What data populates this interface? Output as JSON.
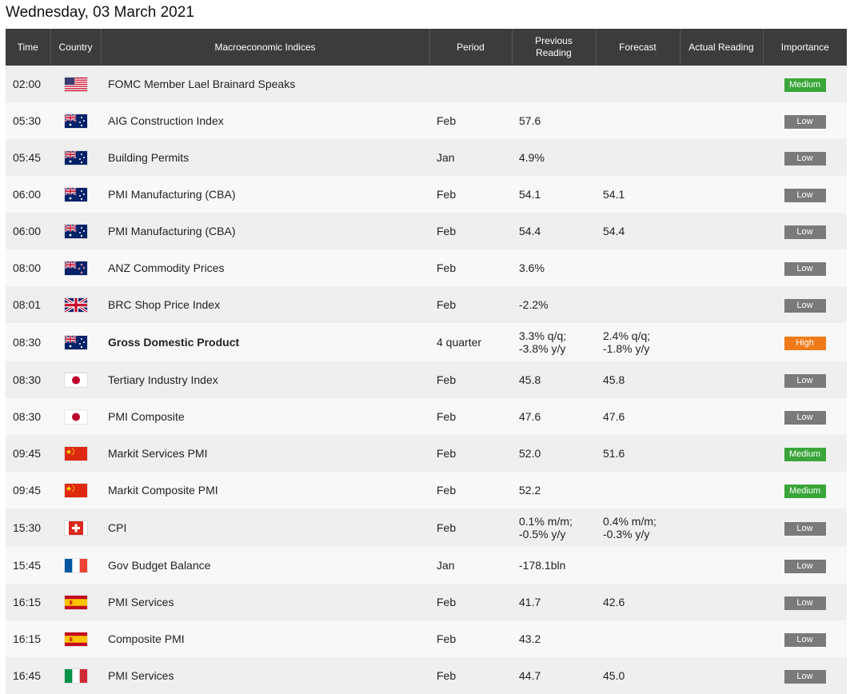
{
  "date_title": "Wednesday, 03 March 2021",
  "headers": {
    "time": "Time",
    "country": "Country",
    "indices": "Macroeconomic Indices",
    "period": "Period",
    "previous": "Previous\nReading",
    "forecast": "Forecast",
    "actual": "Actual Reading",
    "importance": "Importance"
  },
  "colors": {
    "header_bg": "#3c3c3c",
    "low": "#7a7a7a",
    "medium": "#3aa63a",
    "high": "#f07a18"
  },
  "rows": [
    {
      "time": "02:00",
      "flag": "us",
      "flag_name": "us-flag-icon",
      "event": "FOMC Member Lael Brainard Speaks",
      "period": "",
      "previous": "",
      "forecast": "",
      "actual": "",
      "importance": "Medium",
      "level": "medium",
      "bold": false
    },
    {
      "time": "05:30",
      "flag": "au",
      "flag_name": "australia-flag-icon",
      "event": "AIG Construction Index",
      "period": "Feb",
      "previous": "57.6",
      "forecast": "",
      "actual": "",
      "importance": "Low",
      "level": "low",
      "bold": false
    },
    {
      "time": "05:45",
      "flag": "au",
      "flag_name": "australia-flag-icon",
      "event": "Building Permits",
      "period": "Jan",
      "previous": "4.9%",
      "forecast": "",
      "actual": "",
      "importance": "Low",
      "level": "low",
      "bold": false
    },
    {
      "time": "06:00",
      "flag": "au",
      "flag_name": "australia-flag-icon",
      "event": "PMI Manufacturing (CBA)",
      "period": "Feb",
      "previous": "54.1",
      "forecast": "54.1",
      "actual": "",
      "importance": "Low",
      "level": "low",
      "bold": false
    },
    {
      "time": "06:00",
      "flag": "au",
      "flag_name": "australia-flag-icon",
      "event": "PMI Manufacturing (CBA)",
      "period": "Feb",
      "previous": "54.4",
      "forecast": "54.4",
      "actual": "",
      "importance": "Low",
      "level": "low",
      "bold": false
    },
    {
      "time": "08:00",
      "flag": "nz",
      "flag_name": "new-zealand-flag-icon",
      "event": "ANZ Commodity Prices",
      "period": "Feb",
      "previous": "3.6%",
      "forecast": "",
      "actual": "",
      "importance": "Low",
      "level": "low",
      "bold": false
    },
    {
      "time": "08:01",
      "flag": "uk",
      "flag_name": "uk-flag-icon",
      "event": "BRC Shop Price Index",
      "period": "Feb",
      "previous": "-2.2%",
      "forecast": "",
      "actual": "",
      "importance": "Low",
      "level": "low",
      "bold": false
    },
    {
      "time": "08:30",
      "flag": "au",
      "flag_name": "australia-flag-icon",
      "event": "Gross Domestic Product",
      "period": "4 quarter",
      "previous": "3.3% q/q;\n-3.8% y/y",
      "forecast": "2.4% q/q;\n-1.8% y/y",
      "actual": "",
      "importance": "High",
      "level": "high",
      "bold": true
    },
    {
      "time": "08:30",
      "flag": "jp",
      "flag_name": "japan-flag-icon",
      "event": "Tertiary Industry Index",
      "period": "Feb",
      "previous": "45.8",
      "forecast": "45.8",
      "actual": "",
      "importance": "Low",
      "level": "low",
      "bold": false
    },
    {
      "time": "08:30",
      "flag": "jp",
      "flag_name": "japan-flag-icon",
      "event": "PMI Composite",
      "period": "Feb",
      "previous": "47.6",
      "forecast": "47.6",
      "actual": "",
      "importance": "Low",
      "level": "low",
      "bold": false
    },
    {
      "time": "09:45",
      "flag": "cn",
      "flag_name": "china-flag-icon",
      "event": "Markit Services PMI",
      "period": "Feb",
      "previous": "52.0",
      "forecast": "51.6",
      "actual": "",
      "importance": "Medium",
      "level": "medium",
      "bold": false
    },
    {
      "time": "09:45",
      "flag": "cn",
      "flag_name": "china-flag-icon",
      "event": "Markit Composite PMI",
      "period": "Feb",
      "previous": "52.2",
      "forecast": "",
      "actual": "",
      "importance": "Medium",
      "level": "medium",
      "bold": false
    },
    {
      "time": "15:30",
      "flag": "ch",
      "flag_name": "switzerland-flag-icon",
      "event": "CPI",
      "period": "Feb",
      "previous": "0.1% m/m;\n-0.5% y/y",
      "forecast": "0.4% m/m;\n-0.3% y/y",
      "actual": "",
      "importance": "Low",
      "level": "low",
      "bold": false
    },
    {
      "time": "15:45",
      "flag": "fr",
      "flag_name": "france-flag-icon",
      "event": "Gov Budget Balance",
      "period": "Jan",
      "previous": "-178.1bln",
      "forecast": "",
      "actual": "",
      "importance": "Low",
      "level": "low",
      "bold": false
    },
    {
      "time": "16:15",
      "flag": "es",
      "flag_name": "spain-flag-icon",
      "event": "PMI Services",
      "period": "Feb",
      "previous": "41.7",
      "forecast": "42.6",
      "actual": "",
      "importance": "Low",
      "level": "low",
      "bold": false
    },
    {
      "time": "16:15",
      "flag": "es",
      "flag_name": "spain-flag-icon",
      "event": "Composite PMI",
      "period": "Feb",
      "previous": "43.2",
      "forecast": "",
      "actual": "",
      "importance": "Low",
      "level": "low",
      "bold": false
    },
    {
      "time": "16:45",
      "flag": "it",
      "flag_name": "italy-flag-icon",
      "event": "PMI Services",
      "period": "Feb",
      "previous": "44.7",
      "forecast": "45.0",
      "actual": "",
      "importance": "Low",
      "level": "low",
      "bold": false
    }
  ]
}
